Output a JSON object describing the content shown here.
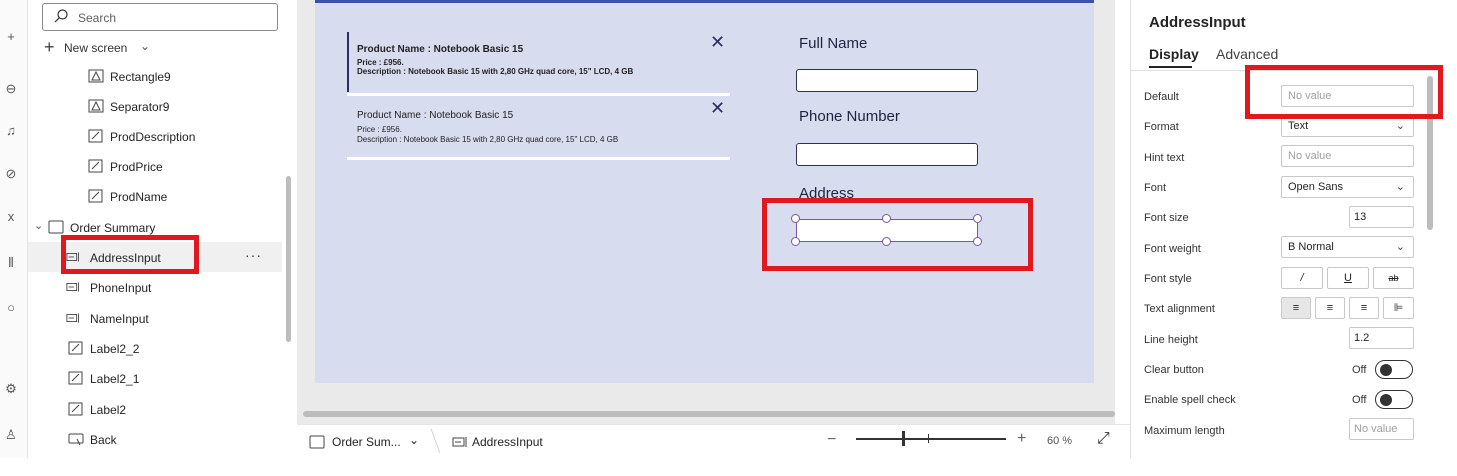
{
  "tree": {
    "search_placeholder": "Search",
    "new_screen_label": "New screen",
    "items": [
      {
        "label": "Rectangle9",
        "icon": "shape-icon"
      },
      {
        "label": "Separator9",
        "icon": "shape-icon"
      },
      {
        "label": "ProdDescription",
        "icon": "label-icon"
      },
      {
        "label": "ProdPrice",
        "icon": "label-icon"
      },
      {
        "label": "ProdName",
        "icon": "label-icon"
      },
      {
        "label": "Order Summary",
        "icon": "screen-icon"
      },
      {
        "label": "AddressInput",
        "icon": "text-input-icon"
      },
      {
        "label": "PhoneInput",
        "icon": "text-input-icon"
      },
      {
        "label": "NameInput",
        "icon": "text-input-icon"
      },
      {
        "label": "Label2_2",
        "icon": "label-icon"
      },
      {
        "label": "Label2_1",
        "icon": "label-icon"
      },
      {
        "label": "Label2",
        "icon": "label-icon"
      },
      {
        "label": "Back",
        "icon": "button-icon"
      }
    ],
    "more_label": "···"
  },
  "canvas": {
    "gallery": [
      {
        "name_line": "Product Name :  Notebook Basic 15",
        "price_line": "Price :  £956.",
        "desc_line": "Description  :  Notebook Basic 15 with 2,80 GHz quad core, 15\" LCD, 4 GB"
      },
      {
        "name_line": "Product Name :  Notebook Basic 15",
        "price_line": "Price :  £956.",
        "desc_line": "Description  :  Notebook Basic 15 with 2,80 GHz quad core, 15\" LCD, 4 GB"
      }
    ],
    "close_glyph": "✕",
    "labels": {
      "full_name": "Full Name",
      "phone": "Phone Number",
      "address": "Address"
    }
  },
  "bottombar": {
    "screen_label": "Order Sum...",
    "control_label": "AddressInput",
    "zoom_minus": "−",
    "zoom_plus": "+",
    "zoom_value": "60  %",
    "expand_glyph": "⤢"
  },
  "props": {
    "control_name": "AddressInput",
    "tabs": [
      "Display",
      "Advanced"
    ],
    "rows": {
      "default_label": "Default",
      "default_value": "No value",
      "format_label": "Format",
      "format_value": "Text",
      "hint_label": "Hint text",
      "hint_value": "No value",
      "font_label": "Font",
      "font_value": "Open Sans",
      "font_size_label": "Font size",
      "font_size_value": "13",
      "font_weight_label": "Font weight",
      "font_weight_value": "B  Normal",
      "font_style_label": "Font style",
      "font_style_buttons": [
        "/",
        "U",
        "ab"
      ],
      "text_align_label": "Text alignment",
      "line_height_label": "Line height",
      "line_height_value": "1.2",
      "clear_button_label": "Clear button",
      "clear_button_state": "Off",
      "spell_check_label": "Enable spell check",
      "spell_check_state": "Off",
      "max_length_label": "Maximum length",
      "max_length_value": "No value"
    }
  },
  "colors": {
    "accent": "#3b53a5",
    "highlight": "#e0191f",
    "screen_bg": "#d8dcef",
    "selection": "#7d55a3"
  }
}
